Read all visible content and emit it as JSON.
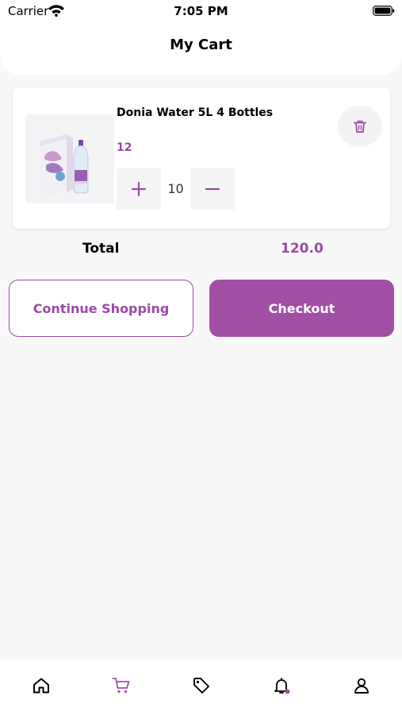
{
  "status_bar": {
    "carrier": "Carrier",
    "time": "7:05 PM"
  },
  "header": {
    "title": "My Cart"
  },
  "cart": {
    "items": [
      {
        "name": "Donia Water 5L 4 Bottles",
        "price": "12",
        "quantity": "10"
      }
    ],
    "total_label": "Total",
    "total_value": "120.0"
  },
  "actions": {
    "continue_label": "Continue Shopping",
    "checkout_label": "Checkout"
  },
  "tabbar": {
    "items": [
      {
        "icon": "home-icon",
        "active": false
      },
      {
        "icon": "cart-icon",
        "active": true
      },
      {
        "icon": "tag-icon",
        "active": false
      },
      {
        "icon": "bell-icon",
        "active": false
      },
      {
        "icon": "user-icon",
        "active": false
      }
    ]
  },
  "colors": {
    "accent": "#a24fa6",
    "background": "#f8f8f8",
    "card": "#ffffff",
    "text": "#000000"
  }
}
